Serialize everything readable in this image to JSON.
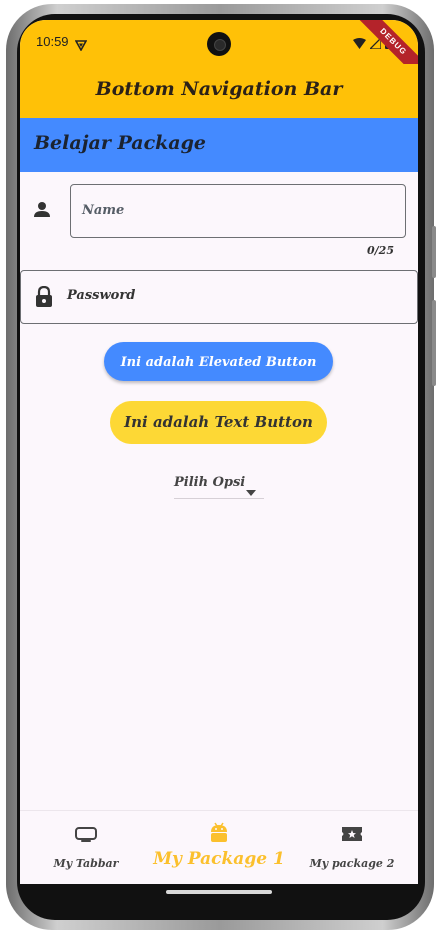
{
  "status_bar": {
    "time": "10:59",
    "debug_label": "DEBUG"
  },
  "app_bar": {
    "title": "Bottom Navigation Bar"
  },
  "sub_bar": {
    "title": "Belajar Package"
  },
  "form": {
    "name_placeholder": "Name",
    "name_counter": "0/25",
    "password_placeholder": "Password"
  },
  "buttons": {
    "elevated_label": "Ini adalah Elevated Button",
    "text_label": "Ini adalah Text Button"
  },
  "dropdown": {
    "selected": "Pilih Opsi"
  },
  "bottom_nav": {
    "items": [
      {
        "label": "My Tabbar",
        "icon": "tv-icon",
        "active": false
      },
      {
        "label": "My Package 1",
        "icon": "android-icon",
        "active": true
      },
      {
        "label": "My package 2",
        "icon": "ticket-icon",
        "active": false
      }
    ]
  },
  "colors": {
    "primary_yellow": "#ffc107",
    "blue": "#448aff",
    "text_button_bg": "#fdd835",
    "active_nav": "#fbc02d",
    "background": "#fcf7fc"
  }
}
